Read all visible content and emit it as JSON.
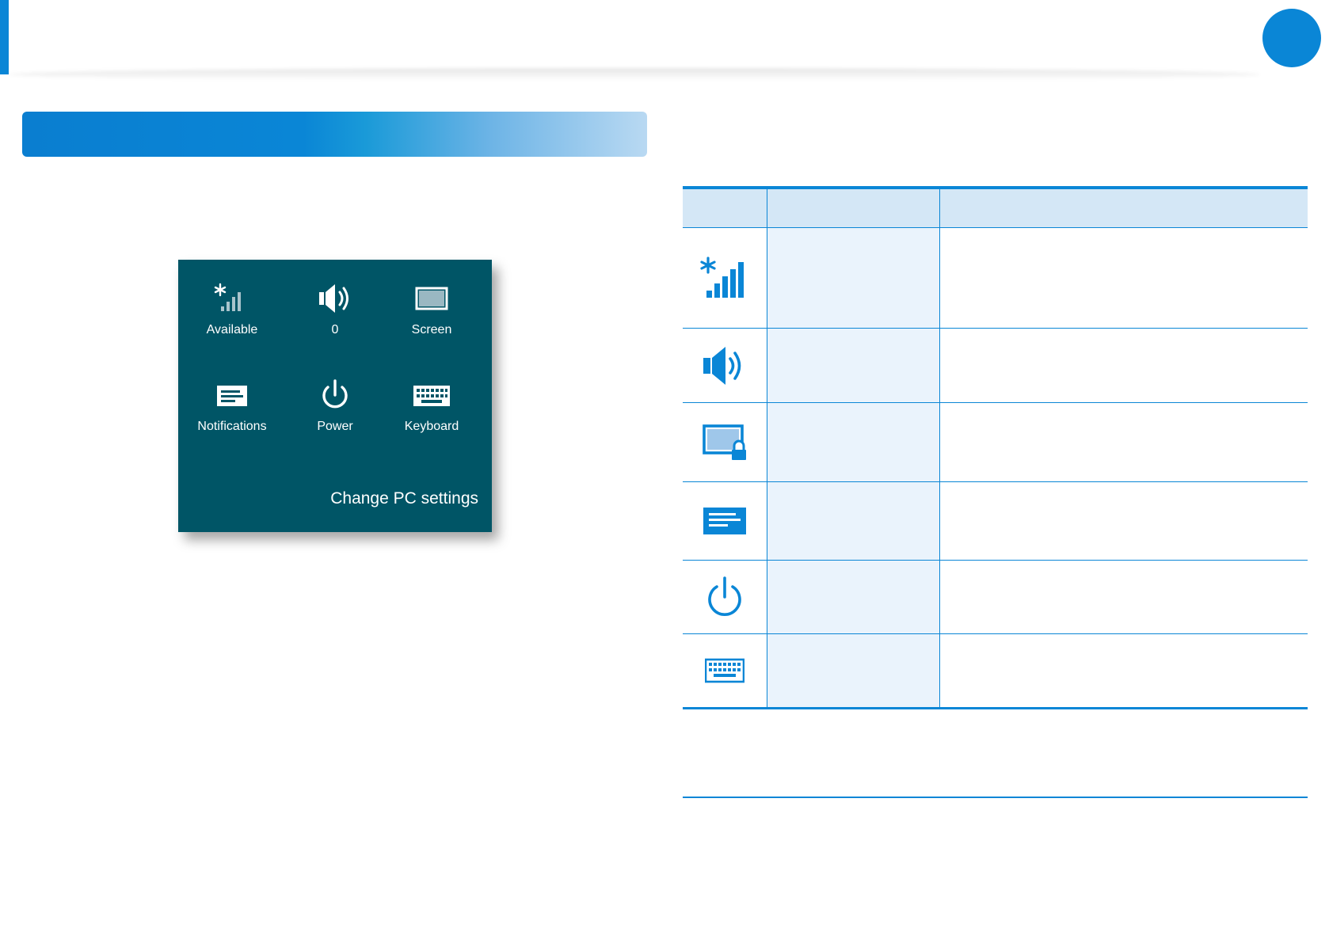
{
  "colors": {
    "accent": "#0a86d6",
    "panel_bg": "#005566",
    "table_header_bg": "#d4e7f6",
    "table_cell_bg": "#eaf3fc"
  },
  "settings_panel": {
    "tiles": [
      {
        "label": "Available",
        "icon": "network-signal-icon"
      },
      {
        "label": "0",
        "icon": "volume-icon"
      },
      {
        "label": "Screen",
        "icon": "screen-icon"
      },
      {
        "label": "Notifications",
        "icon": "notifications-icon"
      },
      {
        "label": "Power",
        "icon": "power-icon"
      },
      {
        "label": "Keyboard",
        "icon": "keyboard-icon"
      }
    ],
    "change_settings_link": "Change PC settings"
  },
  "table": {
    "rows": [
      {
        "icon": "network-signal-icon"
      },
      {
        "icon": "volume-icon"
      },
      {
        "icon": "screen-lock-icon"
      },
      {
        "icon": "notifications-icon"
      },
      {
        "icon": "power-icon"
      },
      {
        "icon": "keyboard-icon"
      }
    ]
  }
}
